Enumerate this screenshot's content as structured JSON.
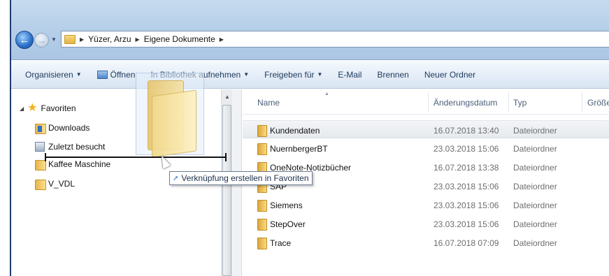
{
  "address": {
    "crumbs": [
      "Yüzer, Arzu",
      "Eigene Dokumente"
    ]
  },
  "toolbar": {
    "organize": "Organisieren",
    "open": "Öffnen",
    "library": "In Bibliothek aufnehmen",
    "share": "Freigeben für",
    "email": "E-Mail",
    "burn": "Brennen",
    "new_folder": "Neuer Ordner"
  },
  "navpane": {
    "favorites": "Favoriten",
    "items": [
      "Downloads",
      "Zuletzt besucht",
      "Kaffee Maschine",
      "V_VDL"
    ]
  },
  "columns": {
    "name": "Name",
    "date": "Änderungsdatum",
    "type": "Typ",
    "size": "Größe"
  },
  "files": [
    {
      "name": "Kundendaten",
      "date": "16.07.2018 13:40",
      "type": "Dateiordner"
    },
    {
      "name": "NuernbergerBT",
      "date": "23.03.2018 15:06",
      "type": "Dateiordner"
    },
    {
      "name": "OneNote-Notizbücher",
      "date": "16.07.2018 13:38",
      "type": "Dateiordner"
    },
    {
      "name": "SAP",
      "date": "23.03.2018 15:06",
      "type": "Dateiordner"
    },
    {
      "name": "Siemens",
      "date": "23.03.2018 15:06",
      "type": "Dateiordner"
    },
    {
      "name": "StepOver",
      "date": "23.03.2018 15:06",
      "type": "Dateiordner"
    },
    {
      "name": "Trace",
      "date": "16.07.2018 07:09",
      "type": "Dateiordner"
    }
  ],
  "drag": {
    "tooltip": "Verknüpfung erstellen in Favoriten"
  }
}
